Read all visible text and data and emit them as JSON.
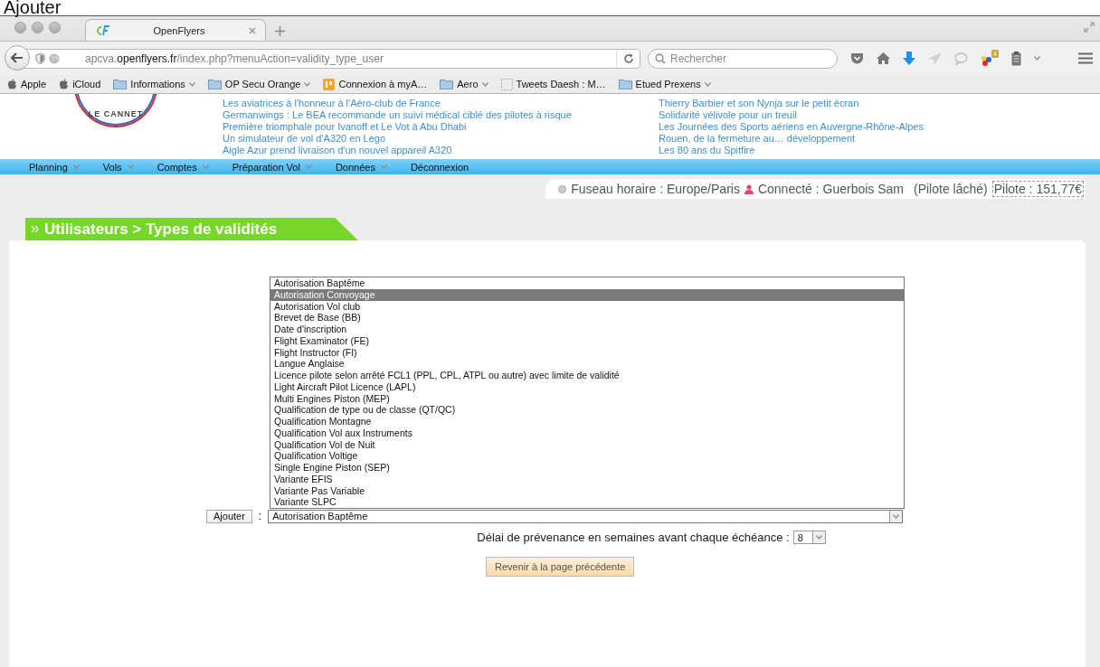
{
  "caption": "Ajouter",
  "browser": {
    "tab": {
      "title": "OpenFlyers",
      "selected": true
    },
    "url": {
      "prefix": "apcva.",
      "domain": "openflyers.fr",
      "path": "/index.php?menuAction=validity_type_user"
    },
    "search": {
      "placeholder": "Rechercher"
    },
    "addon_badge": "4",
    "bookmarks": [
      {
        "label": "Apple",
        "kind": "apple",
        "dropdown": false
      },
      {
        "label": "iCloud",
        "kind": "apple",
        "dropdown": false
      },
      {
        "label": "Informations",
        "kind": "folder",
        "dropdown": true
      },
      {
        "label": "OP Secu Orange",
        "kind": "folder",
        "dropdown": true
      },
      {
        "label": "Connexion à myA…",
        "kind": "app",
        "dropdown": false
      },
      {
        "label": "Aero",
        "kind": "folder",
        "dropdown": true
      },
      {
        "label": "Tweets Daesh : M…",
        "kind": "page",
        "dropdown": false
      },
      {
        "label": "Etued Prexens",
        "kind": "folder",
        "dropdown": true
      }
    ]
  },
  "site": {
    "logo_text": "LE CANNET",
    "news_left": [
      "Les aviatrices à l'honneur à l'Aéro-club de France",
      "Germanwings : Le BEA recommande un suivi médical ciblé des pilotes à risque",
      "Première triomphale pour Ivanoff et Le Vot à Abu Dhabi",
      "Un simulateur de vol d'A320 en Lego",
      "Aigle Azur prend livraison d'un nouvel appareil A320"
    ],
    "news_right": [
      "Thierry Barbier et son Nynja sur le petit écran",
      "Solidarité vélivole pour un treuil",
      "Les Journées des Sports aériens en Auvergne-Rhône-Alpes",
      "Rouen, de la fermeture au… développement",
      "Les 80 ans du Spitfire"
    ],
    "menu": [
      {
        "label": "Planning",
        "dropdown": true
      },
      {
        "label": "Vols",
        "dropdown": true
      },
      {
        "label": "Comptes",
        "dropdown": true
      },
      {
        "label": "Préparation Vol",
        "dropdown": true
      },
      {
        "label": "Données",
        "dropdown": true
      },
      {
        "label": "Déconnexion",
        "dropdown": false
      }
    ],
    "status": {
      "timezone": "Fuseau horaire : Europe/Paris",
      "user": "Connecté : Guerbois Sam",
      "role": "(Pilote lâché)",
      "balance": "Pilote : 151,77€"
    }
  },
  "page": {
    "heading": "Utilisateurs > Types de validités",
    "validity_types": [
      {
        "label": "Autorisation Baptême",
        "selected": false
      },
      {
        "label": "Autorisation Convoyage",
        "selected": true
      },
      {
        "label": "Autorisation Vol club",
        "selected": false
      },
      {
        "label": "Brevet de Base (BB)",
        "selected": false
      },
      {
        "label": "Date d'inscription",
        "selected": false
      },
      {
        "label": "Flight Examinator (FE)",
        "selected": false
      },
      {
        "label": "Flight Instructor (FI)",
        "selected": false
      },
      {
        "label": "Langue Anglaise",
        "selected": false
      },
      {
        "label": "Licence pilote selon arrêté FCL1 (PPL, CPL, ATPL ou autre) avec limite de validité",
        "selected": false
      },
      {
        "label": "Light Aircraft Pilot Licence (LAPL)",
        "selected": false
      },
      {
        "label": "Multi Engines Piston (MEP)",
        "selected": false
      },
      {
        "label": "Qualification de type ou de classe (QT/QC)",
        "selected": false
      },
      {
        "label": "Qualification Montagne",
        "selected": false
      },
      {
        "label": "Qualification Vol aux Instruments",
        "selected": false
      },
      {
        "label": "Qualification Vol de Nuit",
        "selected": false
      },
      {
        "label": "Qualification Voltige",
        "selected": false
      },
      {
        "label": "Single Engine Piston (SEP)",
        "selected": false
      },
      {
        "label": "Variante EFIS",
        "selected": false
      },
      {
        "label": "Variante Pas Variable",
        "selected": false
      },
      {
        "label": "Variante SLPC",
        "selected": false
      }
    ],
    "add_button": "Ajouter",
    "separator": ":",
    "combo_value": "Autorisation Baptême",
    "notice_label": "Délai de prévenance en semaines avant chaque échéance :",
    "notice_value": "8",
    "back_button": "Revenir à la page précédente"
  }
}
